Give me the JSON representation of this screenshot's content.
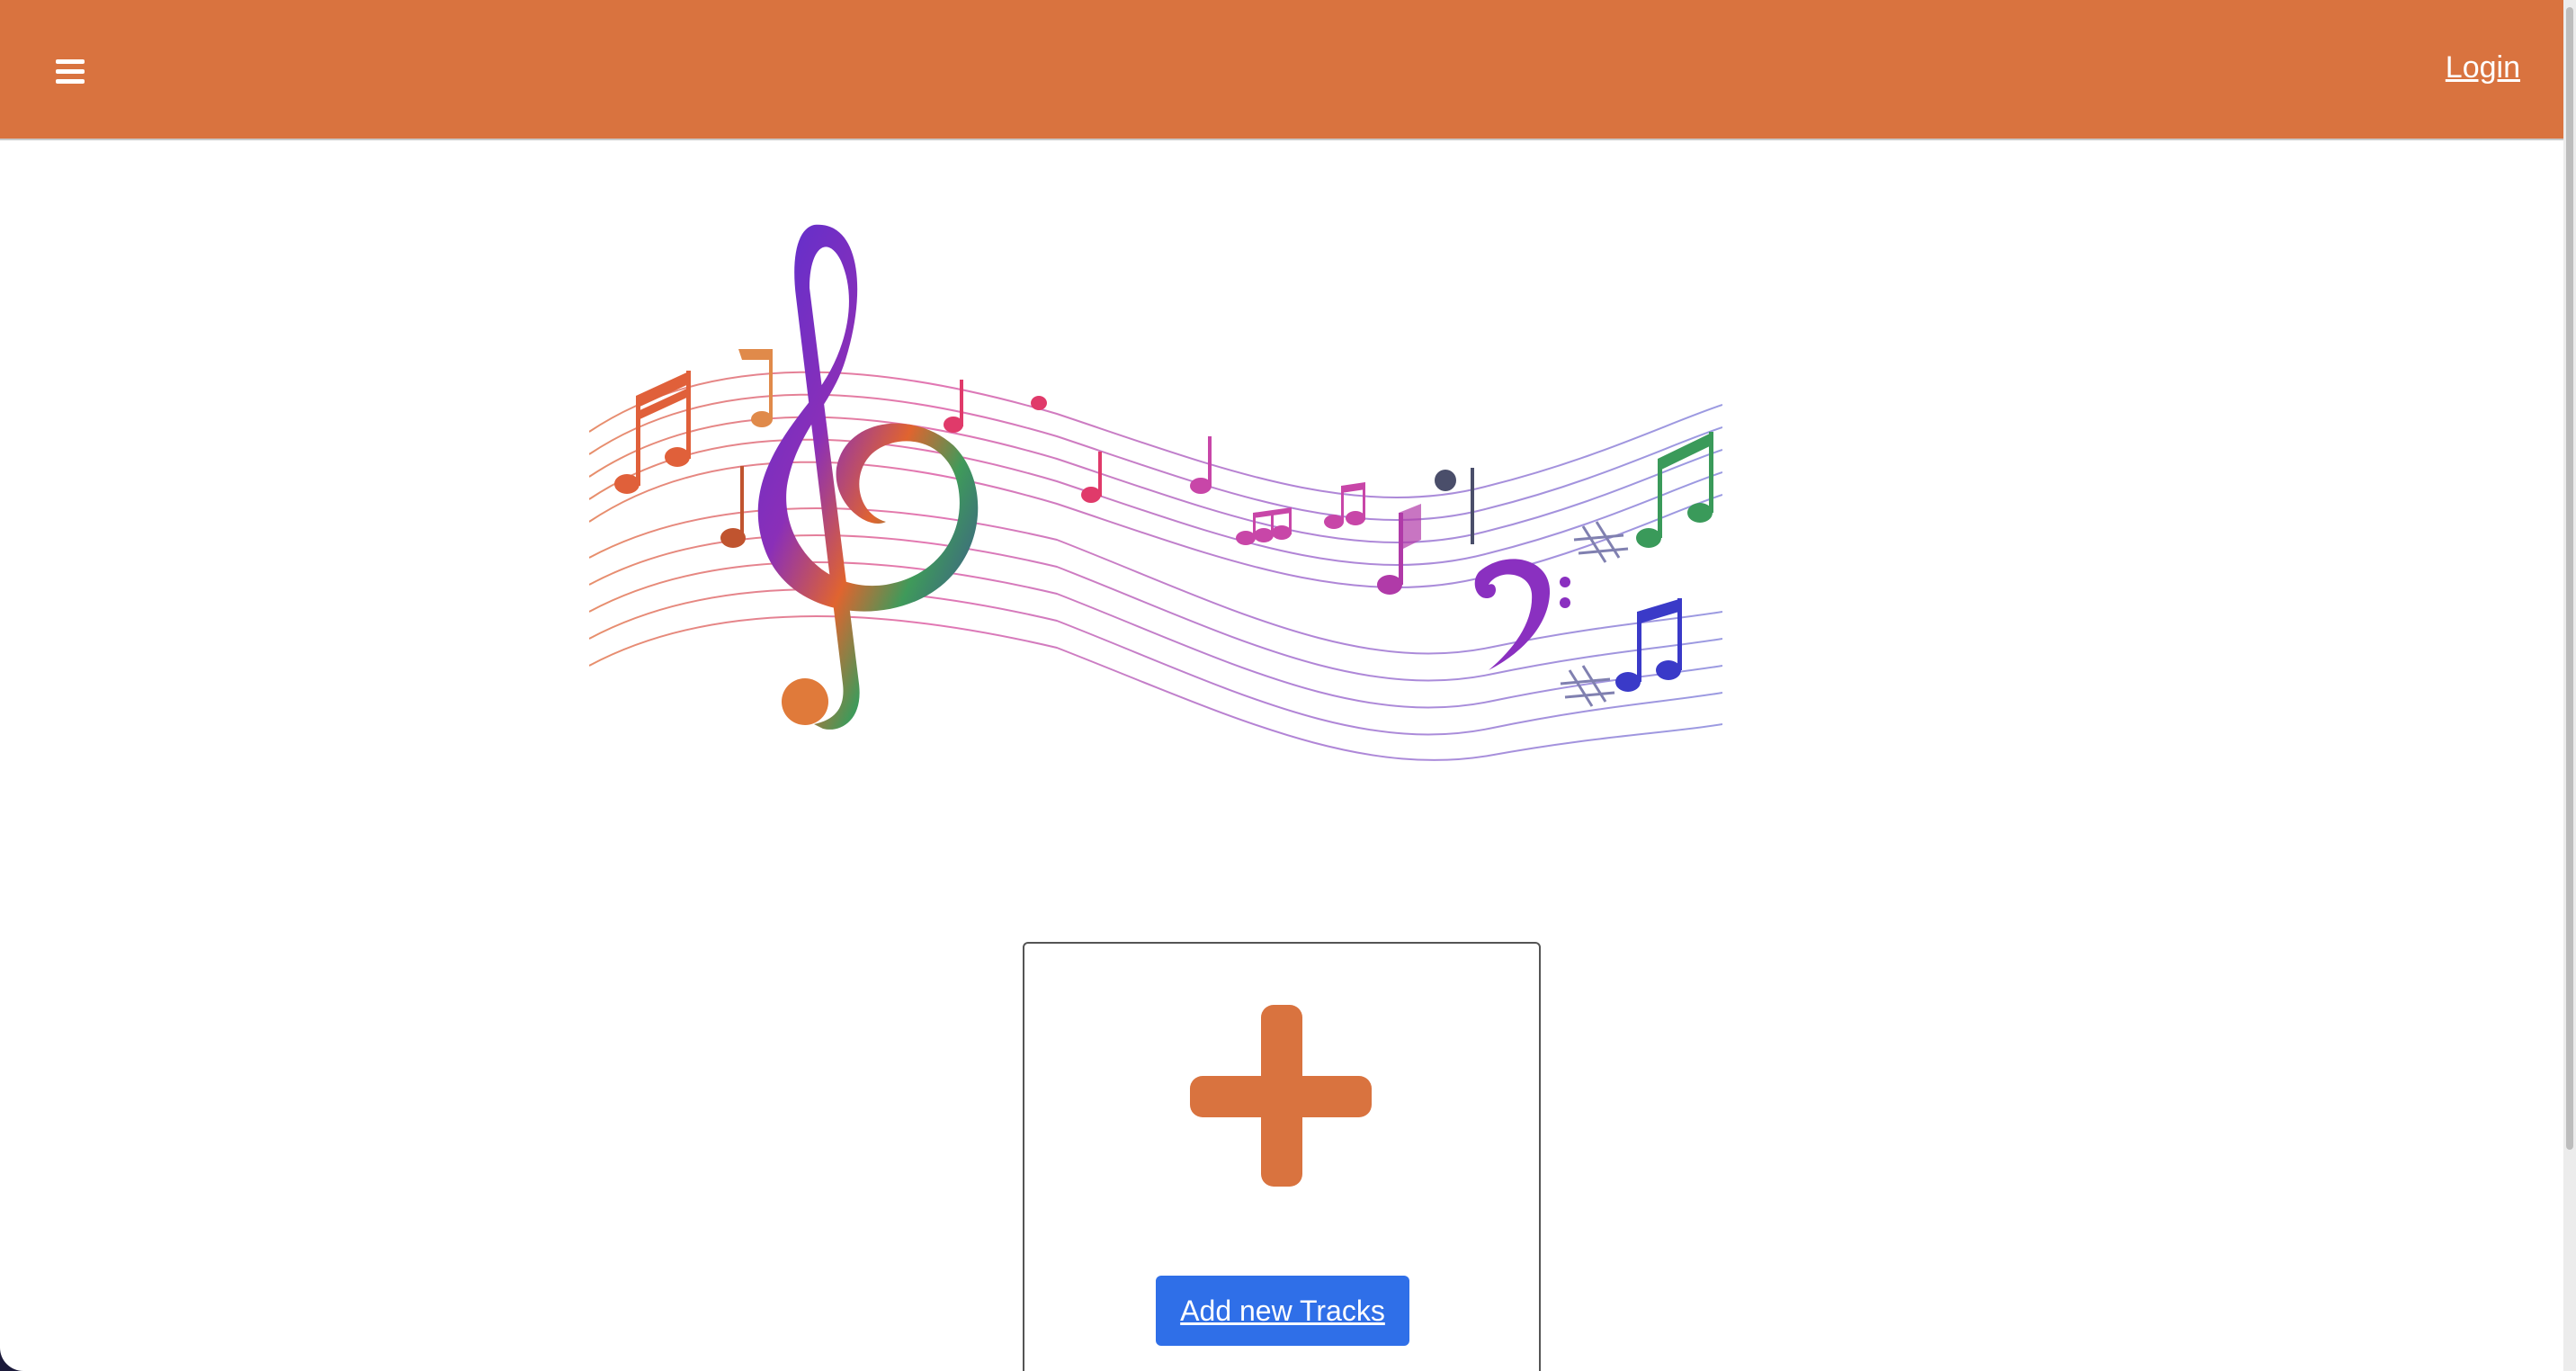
{
  "header": {
    "menu_icon": "hamburger-menu-icon",
    "login_label": "Login",
    "background_color": "#d9733f"
  },
  "hero": {
    "image": "colorful-music-notes-treble-clef-illustration"
  },
  "add_card": {
    "icon": "plus-icon",
    "icon_color": "#d9733f",
    "button_label": "Add new Tracks",
    "button_color": "#2f6fe8"
  }
}
